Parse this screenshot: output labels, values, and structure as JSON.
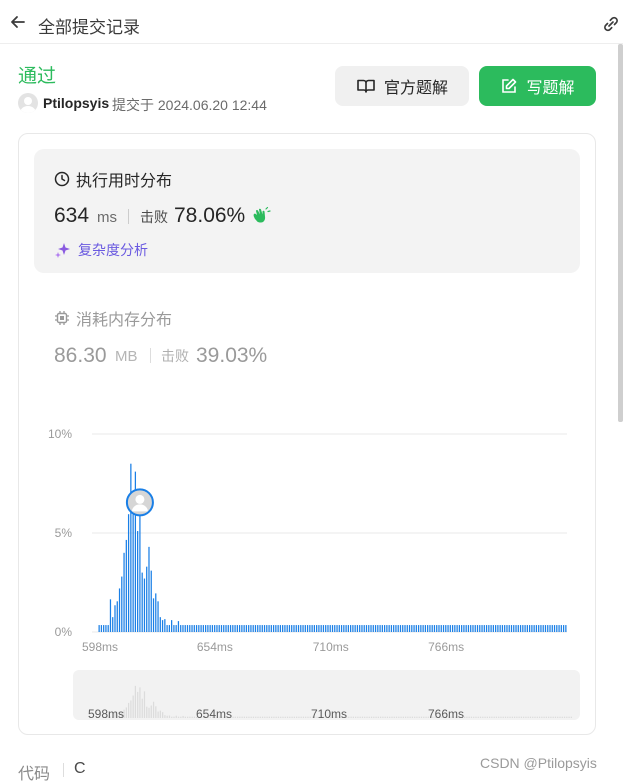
{
  "header": {
    "title": "全部提交记录",
    "back_icon": "arrow-left-icon",
    "link_icon": "link-icon"
  },
  "submission": {
    "status": "通过",
    "status_color": "#2cbb5d",
    "author": "Ptilopsyis",
    "submitted_label": "提交于 2024.06.20 12:44"
  },
  "actions": {
    "official_solution": "官方题解",
    "write_solution": "写题解",
    "write_color": "#2cbb5d"
  },
  "runtime": {
    "title": "执行用时分布",
    "value": "634",
    "unit": "ms",
    "beat_label": "击败",
    "beat_value": "78.06%",
    "complexity_label": "复杂度分析"
  },
  "memory": {
    "title": "消耗内存分布",
    "value": "86.30",
    "unit": "MB",
    "beat_label": "击败",
    "beat_value": "39.03%"
  },
  "chart_data": {
    "type": "bar",
    "y_tick_labels": [
      "10%",
      "5%",
      "0%"
    ],
    "ylim": [
      0,
      10
    ],
    "x_tick_labels": [
      "598ms",
      "654ms",
      "710ms",
      "766ms"
    ],
    "highlighted_index": 18,
    "bar_color": "#1a7fe6",
    "values": [
      0.35,
      0.35,
      0.35,
      0.35,
      0.35,
      1.65,
      0.75,
      1.35,
      1.55,
      2.2,
      2.8,
      4.0,
      4.65,
      5.95,
      8.5,
      6.9,
      8.1,
      5.1,
      7.05,
      3.0,
      2.7,
      3.3,
      4.3,
      3.1,
      1.7,
      1.95,
      1.55,
      0.75,
      0.6,
      0.65,
      0.35,
      0.35,
      0.6,
      0.35,
      0.35,
      0.55,
      0.35,
      0.35,
      0.35,
      0.35,
      0.35,
      0.35,
      0.35,
      0.35,
      0.35,
      0.35,
      0.35,
      0.35,
      0.35,
      0.35,
      0.35,
      0.35,
      0.35,
      0.35,
      0.35,
      0.35,
      0.35,
      0.35,
      0.35,
      0.35,
      0.35,
      0.35,
      0.35,
      0.35,
      0.35,
      0.35,
      0.35,
      0.35,
      0.35,
      0.35,
      0.35,
      0.35,
      0.35,
      0.35,
      0.35,
      0.35,
      0.35,
      0.35,
      0.35,
      0.35,
      0.35,
      0.35,
      0.35,
      0.35,
      0.35,
      0.35,
      0.35,
      0.35,
      0.35,
      0.35,
      0.35,
      0.35,
      0.35,
      0.35,
      0.35,
      0.35,
      0.35,
      0.35,
      0.35,
      0.35,
      0.35,
      0.35,
      0.35,
      0.35,
      0.35,
      0.35,
      0.35,
      0.35,
      0.35,
      0.35,
      0.35,
      0.35,
      0.35,
      0.35,
      0.35,
      0.35,
      0.35,
      0.35,
      0.35,
      0.35,
      0.35,
      0.35,
      0.35,
      0.35,
      0.35,
      0.35,
      0.35,
      0.35,
      0.35,
      0.35,
      0.35,
      0.35,
      0.35,
      0.35,
      0.35,
      0.35,
      0.35,
      0.35,
      0.35,
      0.35,
      0.35,
      0.35,
      0.35,
      0.35,
      0.35,
      0.35,
      0.35,
      0.35,
      0.35,
      0.35,
      0.35,
      0.35,
      0.35,
      0.35,
      0.35,
      0.35,
      0.35,
      0.35,
      0.35,
      0.35,
      0.35,
      0.35,
      0.35,
      0.35,
      0.35,
      0.35,
      0.35,
      0.35,
      0.35,
      0.35,
      0.35,
      0.35,
      0.35,
      0.35,
      0.35,
      0.35,
      0.35,
      0.35,
      0.35,
      0.35,
      0.35,
      0.35,
      0.35,
      0.35,
      0.35,
      0.35,
      0.35,
      0.35,
      0.35,
      0.35,
      0.35,
      0.35,
      0.35,
      0.35,
      0.35,
      0.35,
      0.35,
      0.35,
      0.35,
      0.35,
      0.35,
      0.35,
      0.35,
      0.35,
      0.35,
      0.35,
      0.35
    ]
  },
  "brush_labels": [
    "598ms",
    "654ms",
    "710ms",
    "766ms"
  ],
  "footer": {
    "code_label": "代码",
    "language": "C",
    "watermark": "CSDN @Ptilopsyis"
  }
}
